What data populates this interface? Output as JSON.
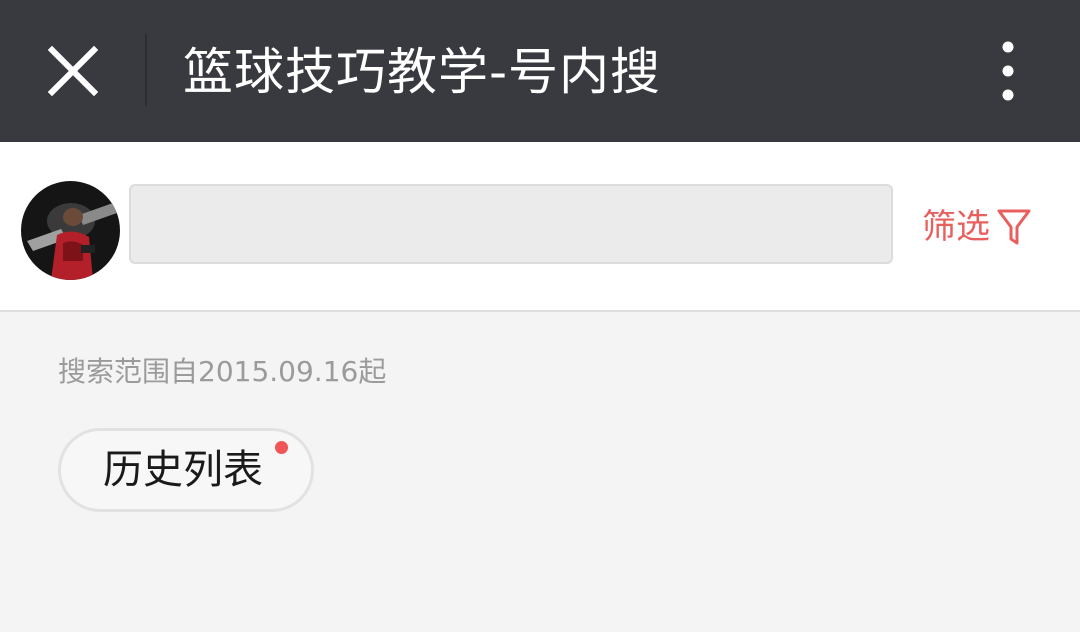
{
  "header": {
    "title": "篮球技巧教学-号内搜",
    "close_icon": "close-icon",
    "more_icon": "more-vertical-icon",
    "background_color": "#393a3f"
  },
  "search": {
    "avatar_icon": "profile-avatar",
    "input_value": "",
    "input_placeholder": "",
    "filter_label": "筛选",
    "filter_icon": "funnel-icon",
    "accent_color": "#e8605d"
  },
  "scope": {
    "text": "搜索范围自2015.09.16起"
  },
  "history": {
    "label": "历史列表",
    "has_unread_dot": true,
    "dot_color": "#f05656"
  }
}
